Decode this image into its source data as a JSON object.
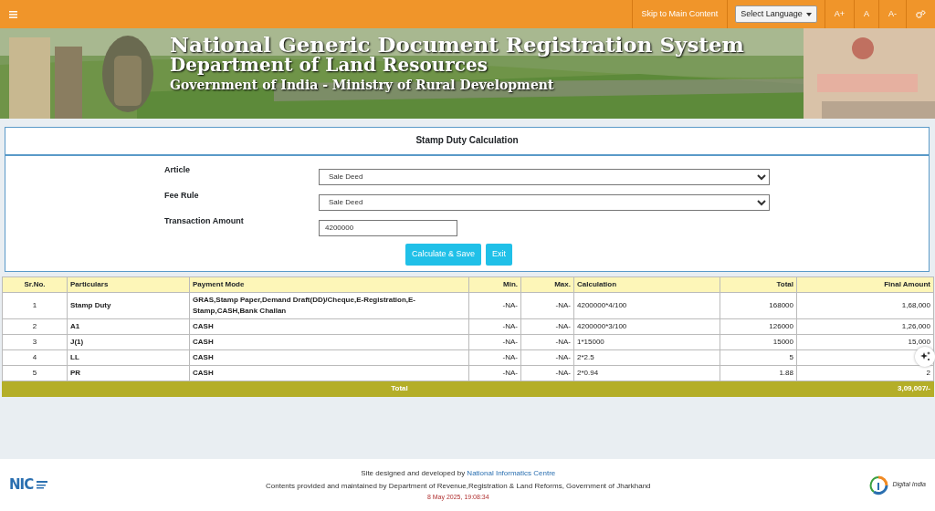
{
  "topbar": {
    "skip_link": "Skip to Main Content",
    "language": "Select Language",
    "font_buttons": [
      "A+",
      "A",
      "A-"
    ]
  },
  "banner": {
    "title": "National Generic Document Registration System",
    "subtitle": "Department of Land Resources",
    "ministry": "Government of India - Ministry of Rural Development"
  },
  "form": {
    "heading": "Stamp Duty Calculation",
    "fields": [
      {
        "kind": "select",
        "label": "Article",
        "value": "Sale Deed"
      },
      {
        "kind": "select",
        "label": "Fee Rule",
        "value": "Sale Deed"
      },
      {
        "kind": "input",
        "label": "Transaction Amount",
        "value": "4200000"
      }
    ],
    "buttons": [
      "Calculate & Save",
      "Exit"
    ]
  },
  "table": {
    "columns": [
      "Sr.No.",
      "Particulars",
      "Payment Mode",
      "Min.",
      "Max.",
      "Calculation",
      "Total",
      "Final Amount"
    ],
    "rows": [
      {
        "sr": "1",
        "particulars": "Stamp Duty",
        "payment_mode": "GRAS,Stamp Paper,Demand Draft(DD)/Cheque,E-Registration,E-Stamp,CASH,Bank Challan",
        "min": "-NA-",
        "max": "-NA-",
        "calculation": "4200000*4/100",
        "total": "168000",
        "final_amount": "1,68,000"
      },
      {
        "sr": "2",
        "particulars": "A1",
        "payment_mode": "CASH",
        "min": "-NA-",
        "max": "-NA-",
        "calculation": "4200000*3/100",
        "total": "126000",
        "final_amount": "1,26,000"
      },
      {
        "sr": "3",
        "particulars": "J(1)",
        "payment_mode": "CASH",
        "min": "-NA-",
        "max": "-NA-",
        "calculation": "1*15000",
        "total": "15000",
        "final_amount": "15,000"
      },
      {
        "sr": "4",
        "particulars": "LL",
        "payment_mode": "CASH",
        "min": "-NA-",
        "max": "-NA-",
        "calculation": "2*2.5",
        "total": "5"
      },
      {
        "sr": "5",
        "particulars": "PR",
        "payment_mode": "CASH",
        "min": "-NA-",
        "max": "-NA-",
        "calculation": "2*0.94",
        "total": "1.88",
        "final_amount": "2"
      }
    ],
    "total_label": "Total",
    "grand_total": "3,09,007/-"
  },
  "footer": {
    "nic_logo": "NIC",
    "credit": "Site designed and developed by ",
    "credit_link": "National Informatics Centre",
    "maintained": "Contents provided and maintained by Department of Revenue,Registration & Land Reforms, Government of Jharkhand",
    "timestamp": "8 May 2025, 19:08:34",
    "digital_india_logo": "Digital India"
  }
}
